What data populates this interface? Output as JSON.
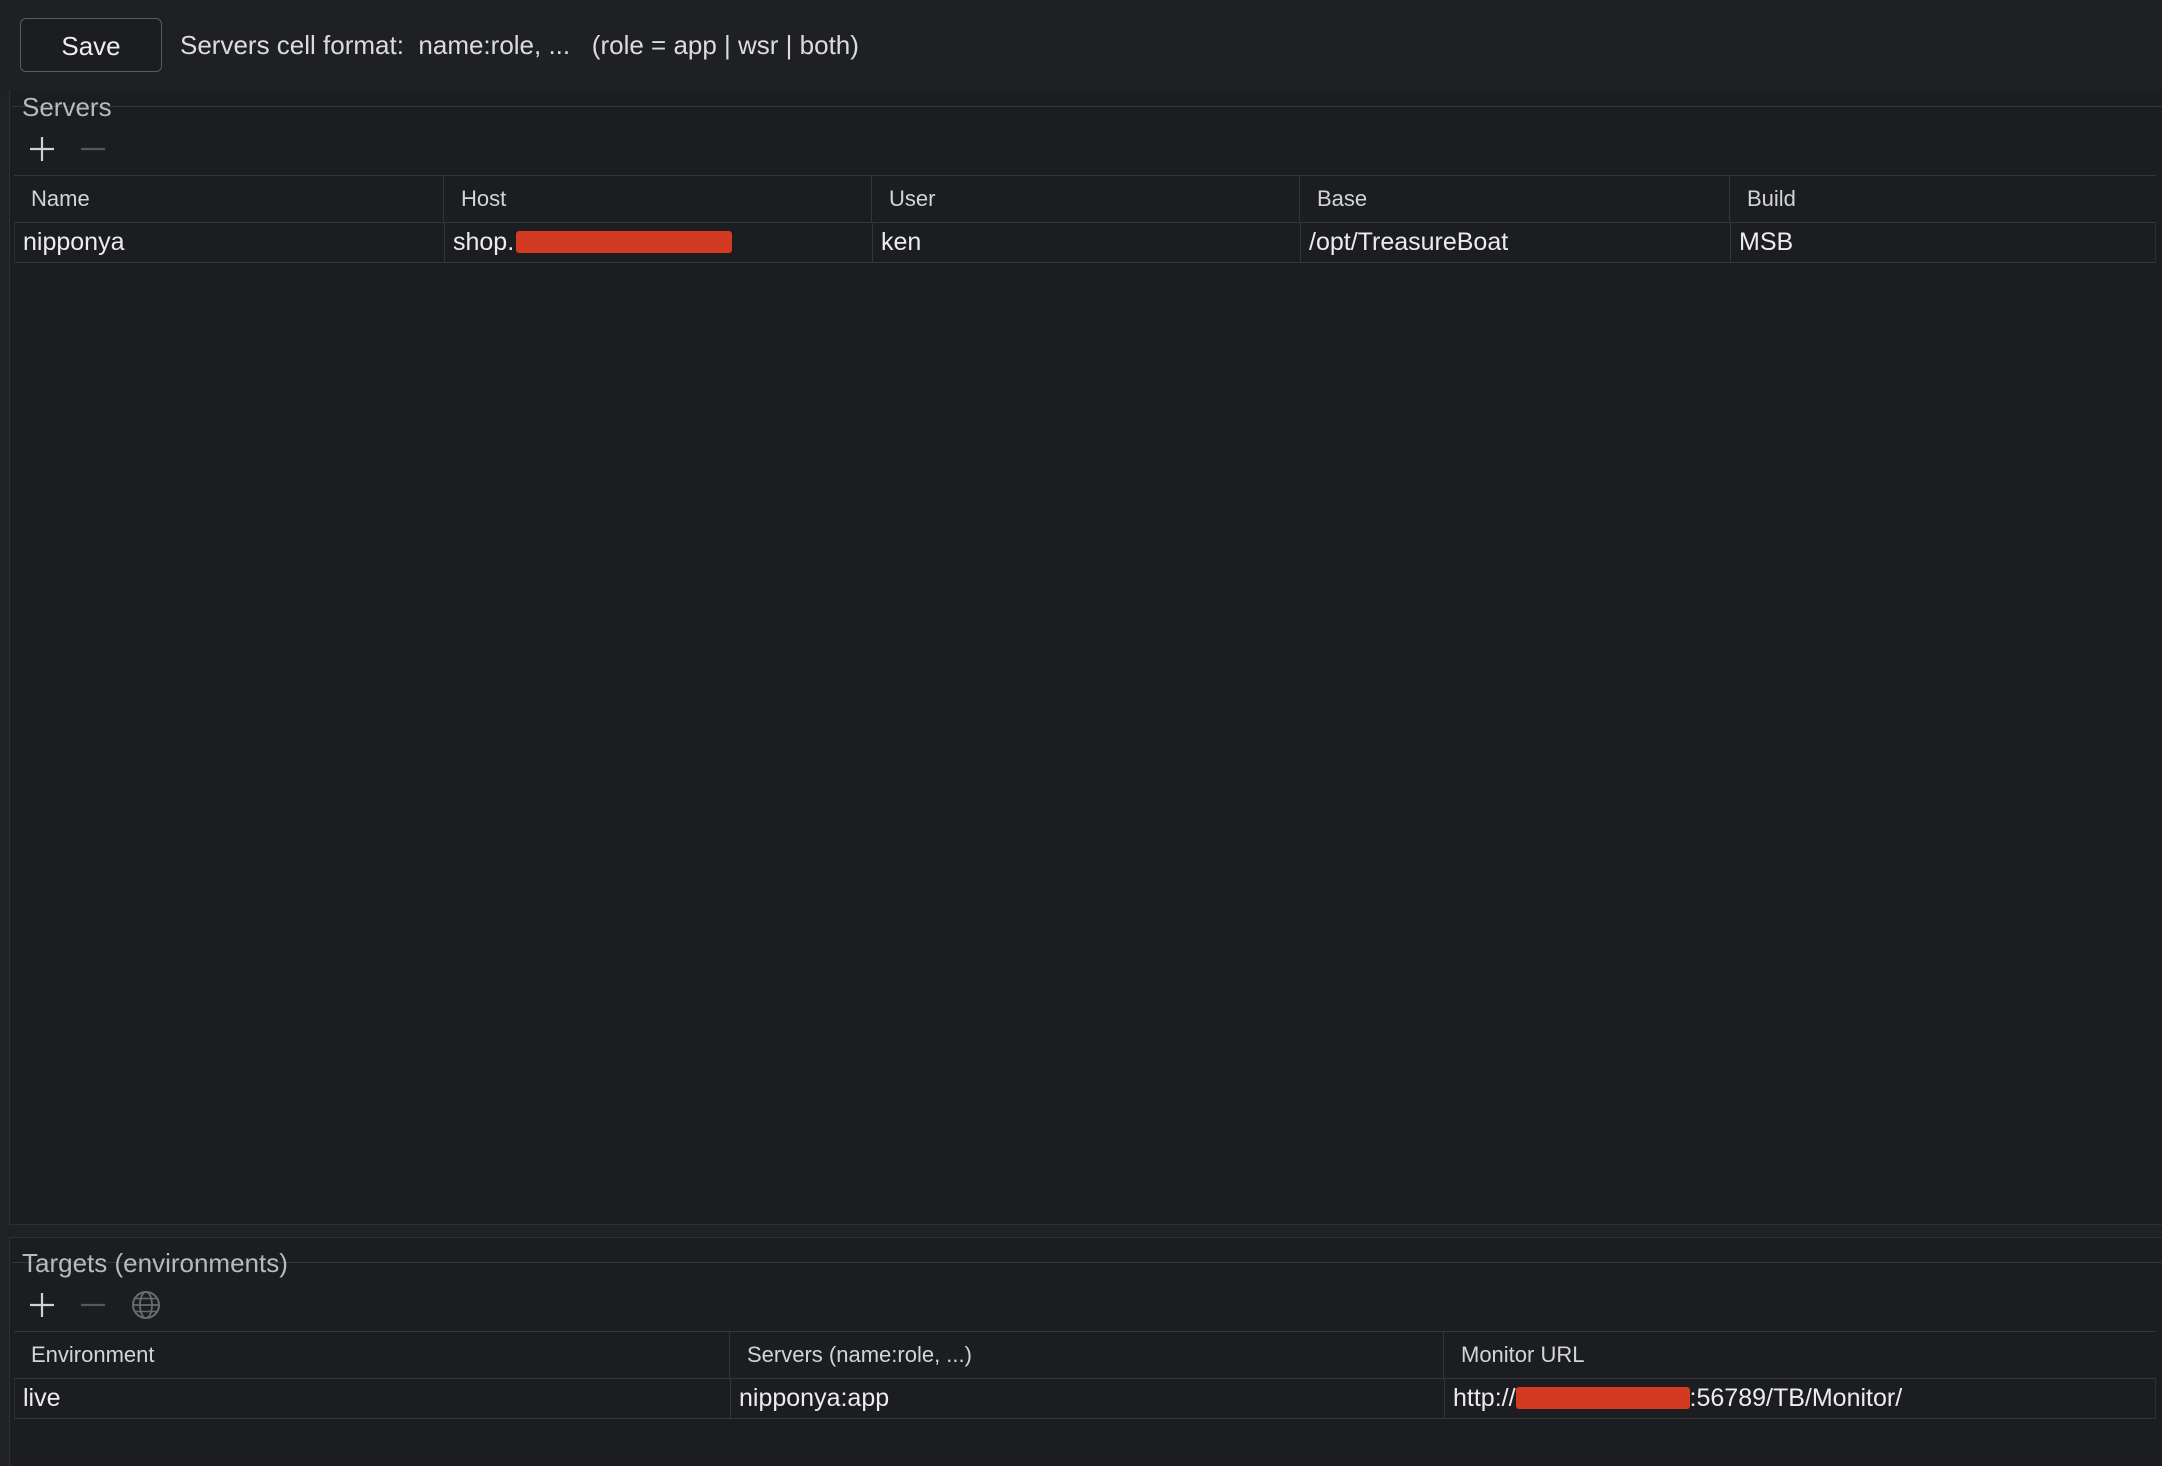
{
  "toolbar": {
    "save_label": "Save",
    "format_hint": "Servers cell format:  name:role, ...   (role = app | wsr | both)"
  },
  "servers": {
    "title": "Servers",
    "add_icon": "plus-icon",
    "remove_icon": "minus-icon",
    "columns": [
      "Name",
      "Host",
      "User",
      "Base",
      "Build"
    ],
    "rows": [
      {
        "name": "nipponya",
        "host_prefix": "shop.",
        "user": "ken",
        "base": "/opt/TreasureBoat",
        "build": "MSB"
      }
    ]
  },
  "targets": {
    "title": "Targets (environments)",
    "add_icon": "plus-icon",
    "remove_icon": "minus-icon",
    "open_icon": "globe-icon",
    "columns": [
      "Environment",
      "Servers (name:role, ...)",
      "Monitor URL"
    ],
    "rows": [
      {
        "environment": "live",
        "servers": "nipponya:app",
        "monitor_prefix": "http://",
        "monitor_suffix": ":56789/TB/Monitor/"
      }
    ]
  },
  "colors": {
    "background": "#1c1d20",
    "redaction": "#d23a22",
    "border": "#34353a"
  }
}
